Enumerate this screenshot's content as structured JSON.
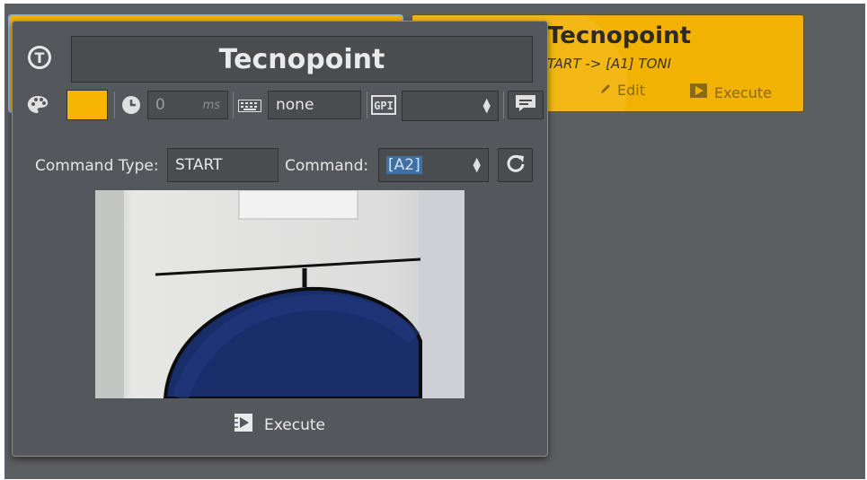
{
  "background_card": {
    "title": "Tecnopoint",
    "subtitle": "TART -> [A1] TONI",
    "edit_label": "Edit",
    "execute_label": "Execute",
    "color": "#f2b203"
  },
  "dialog": {
    "name": "Tecnopoint",
    "logo_letter": "T",
    "color_value": "#f7b404",
    "delay": {
      "value": "0",
      "unit": "ms"
    },
    "keyboard_shortcut": "none",
    "gpi_label": "GPI",
    "gpi_selected": "",
    "command_type_label": "Command Type:",
    "command_type_value": "START",
    "command_label": "Command:",
    "command_value": "[A2]",
    "execute_label": "Execute"
  },
  "icons": {
    "logo": "tecnopoint-logo-icon",
    "palette": "palette-icon",
    "clock": "clock-icon",
    "keyboard": "keyboard-icon",
    "gpi": "gpi-icon",
    "comment": "comment-icon",
    "refresh": "refresh-icon",
    "execute": "execute-icon",
    "edit": "pencil-icon"
  }
}
